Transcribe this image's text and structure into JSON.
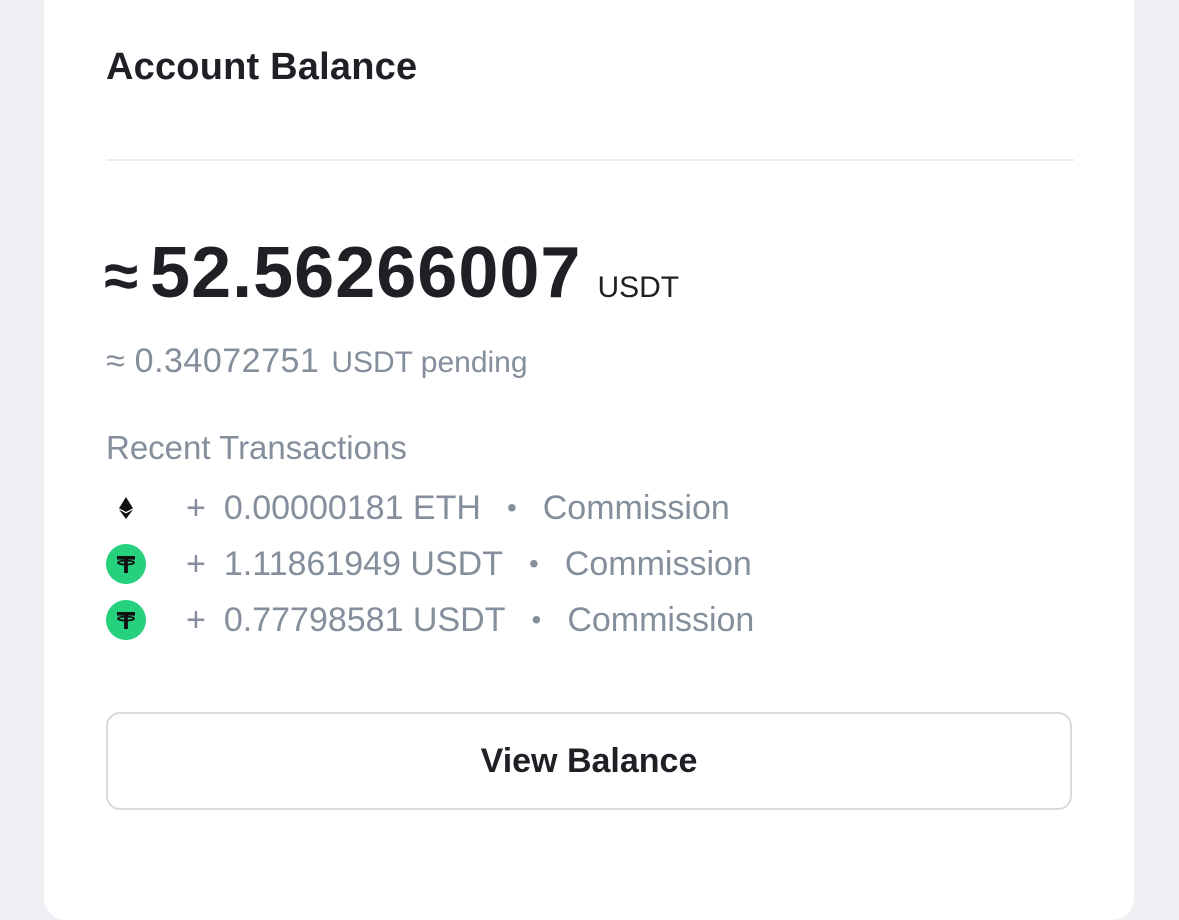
{
  "card": {
    "title": "Account Balance"
  },
  "balance": {
    "approx_symbol": "≈",
    "amount": "52.56266007",
    "unit": "USDT"
  },
  "pending": {
    "approx_symbol": "≈",
    "amount": "0.34072751",
    "label": "USDT pending"
  },
  "transactions": {
    "label": "Recent Transactions",
    "items": [
      {
        "icon": "ethereum-icon",
        "sign": "+",
        "amount": "0.00000181 ETH",
        "separator": "•",
        "type": "Commission"
      },
      {
        "icon": "tether-icon",
        "sign": "+",
        "amount": "1.11861949 USDT",
        "separator": "•",
        "type": "Commission"
      },
      {
        "icon": "tether-icon",
        "sign": "+",
        "amount": "0.77798581 USDT",
        "separator": "•",
        "type": "Commission"
      }
    ]
  },
  "actions": {
    "view_balance_label": "View Balance"
  },
  "colors": {
    "background": "#eff0f4",
    "card": "#ffffff",
    "text_primary": "#1e2026",
    "text_secondary": "#848e9c",
    "tether_green": "#26d07c",
    "divider": "#eaecef"
  }
}
